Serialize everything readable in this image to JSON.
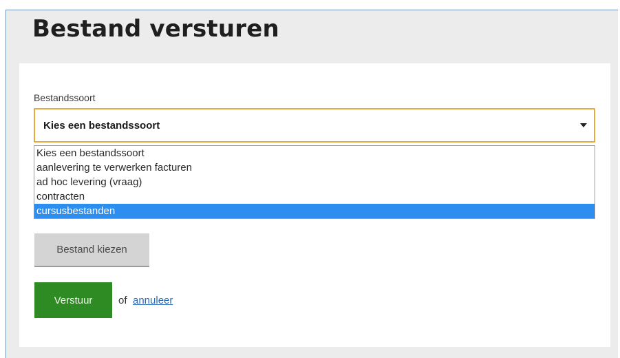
{
  "page": {
    "title": "Bestand versturen"
  },
  "form": {
    "file_type_label": "Bestandssoort",
    "file_type_selected": "Kies een bestandssoort",
    "file_type_options": [
      "Kies een bestandssoort",
      "aanlevering te verwerken facturen",
      "ad hoc levering (vraag)",
      "contracten",
      "cursusbestanden"
    ],
    "highlighted_option": "cursusbestanden",
    "choose_file_label": "Bestand kiezen",
    "submit_label": "Verstuur",
    "or_text": "of",
    "cancel_label": "annuleer"
  },
  "colors": {
    "focus_border": "#e8a93c",
    "highlight": "#2d8ef0",
    "submit_green": "#2e8a22",
    "link_blue": "#2a6bb8"
  }
}
